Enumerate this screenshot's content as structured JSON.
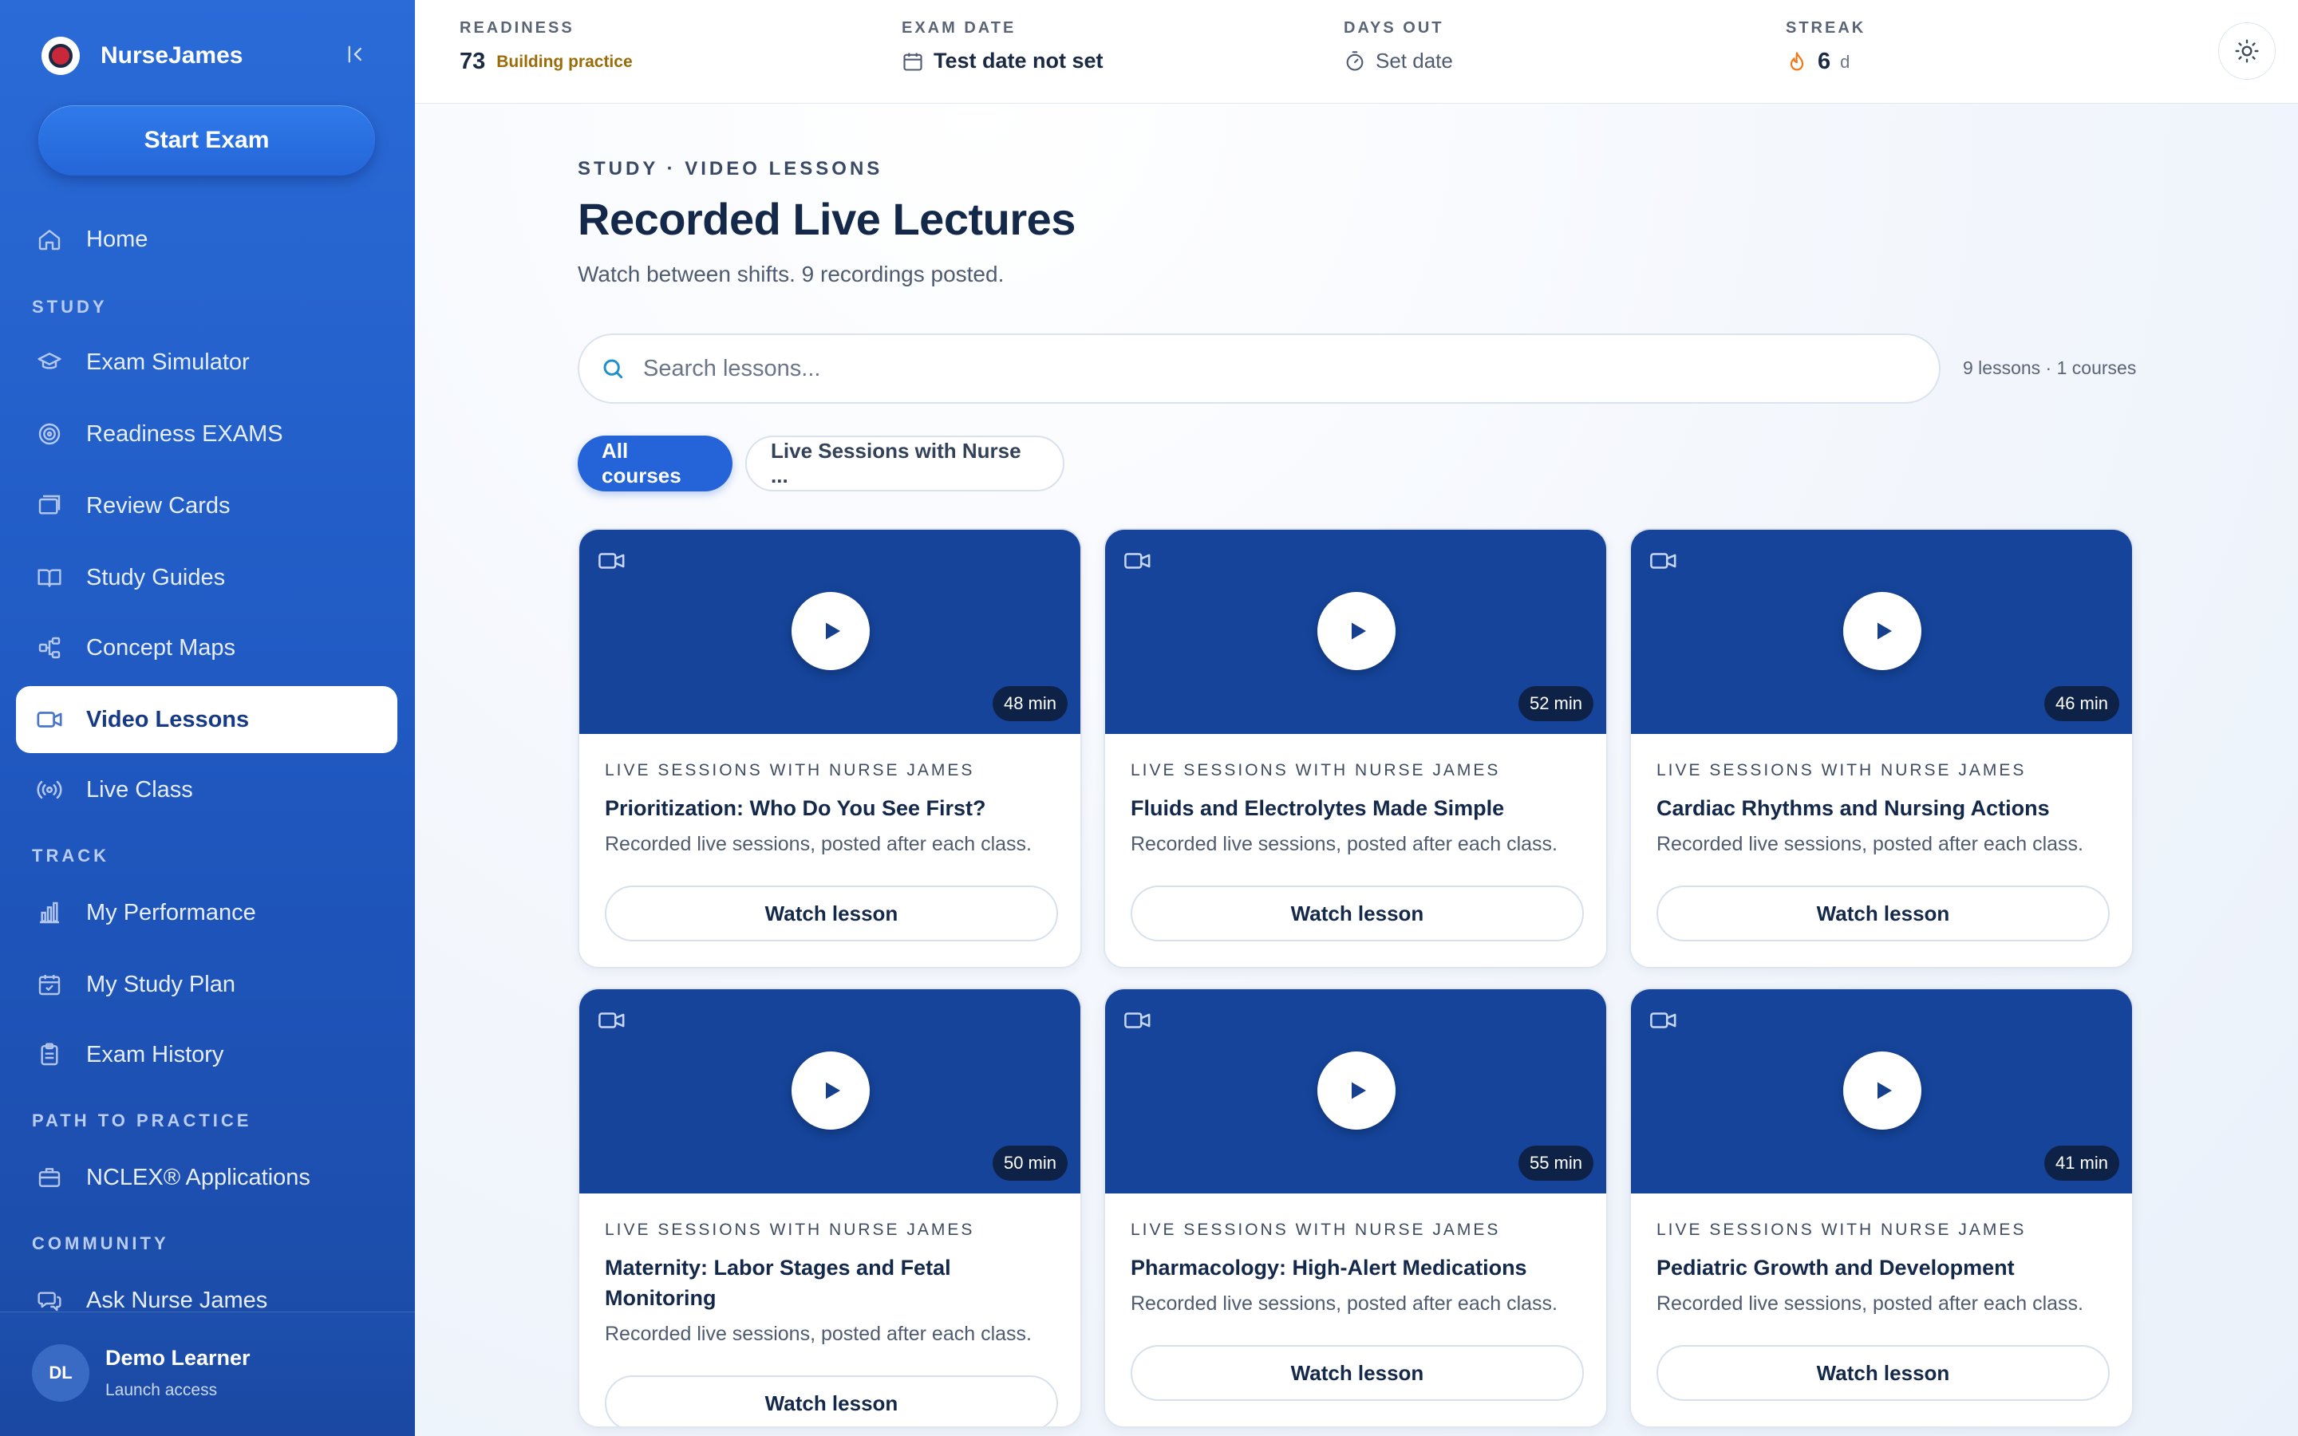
{
  "brand": {
    "name": "NurseJames"
  },
  "sidebar": {
    "start_button": "Start Exam",
    "home": "Home",
    "sections": {
      "study": "STUDY",
      "track": "TRACK",
      "path": "PATH TO PRACTICE",
      "community": "COMMUNITY"
    },
    "study_items": [
      {
        "label": "Exam Simulator",
        "icon": "graduation-cap-icon"
      },
      {
        "label": "Readiness EXAMS",
        "icon": "target-icon"
      },
      {
        "label": "Review Cards",
        "icon": "cards-icon"
      },
      {
        "label": "Study Guides",
        "icon": "book-icon"
      },
      {
        "label": "Concept Maps",
        "icon": "network-icon"
      },
      {
        "label": "Video Lessons",
        "icon": "video-icon",
        "active": true
      },
      {
        "label": "Live Class",
        "icon": "broadcast-icon"
      }
    ],
    "track_items": [
      {
        "label": "My Performance",
        "icon": "bar-chart-icon"
      },
      {
        "label": "My Study Plan",
        "icon": "calendar-check-icon"
      },
      {
        "label": "Exam History",
        "icon": "clipboard-icon"
      }
    ],
    "path_items": [
      {
        "label": "NCLEX® Applications",
        "icon": "briefcase-icon"
      }
    ],
    "community_items": [
      {
        "label": "Ask Nurse James",
        "icon": "chat-icon"
      }
    ],
    "user": {
      "initials": "DL",
      "name": "Demo Learner",
      "sub": "Launch access"
    }
  },
  "topbar": {
    "readiness": {
      "label": "READINESS",
      "value": "73",
      "note": "Building practice"
    },
    "exam_date": {
      "label": "EXAM DATE",
      "value": "Test date not set"
    },
    "days_out": {
      "label": "DAYS OUT",
      "value": "Set date"
    },
    "streak": {
      "label": "STREAK",
      "value": "6",
      "unit": "d"
    }
  },
  "main": {
    "eyebrow": "STUDY · VIDEO LESSONS",
    "title": "Recorded Live Lectures",
    "subtitle": "Watch between shifts. 9 recordings posted.",
    "search_placeholder": "Search lessons...",
    "count_meta": "9 lessons · 1 courses",
    "filters": [
      "All courses",
      "Live Sessions with Nurse ..."
    ],
    "cards": [
      {
        "eyebrow": "LIVE SESSIONS WITH NURSE JAMES",
        "title": "Prioritization: Who Do You See First?",
        "desc": "Recorded live sessions, posted after each class.",
        "duration": "48 min",
        "button": "Watch lesson"
      },
      {
        "eyebrow": "LIVE SESSIONS WITH NURSE JAMES",
        "title": "Fluids and Electrolytes Made Simple",
        "desc": "Recorded live sessions, posted after each class.",
        "duration": "52 min",
        "button": "Watch lesson"
      },
      {
        "eyebrow": "LIVE SESSIONS WITH NURSE JAMES",
        "title": "Cardiac Rhythms and Nursing Actions",
        "desc": "Recorded live sessions, posted after each class.",
        "duration": "46 min",
        "button": "Watch lesson"
      },
      {
        "eyebrow": "LIVE SESSIONS WITH NURSE JAMES",
        "title": "Maternity: Labor Stages and Fetal Monitoring",
        "desc": "Recorded live sessions, posted after each class.",
        "duration": "50 min",
        "button": "Watch lesson"
      },
      {
        "eyebrow": "LIVE SESSIONS WITH NURSE JAMES",
        "title": "Pharmacology: High-Alert Medications",
        "desc": "Recorded live sessions, posted after each class.",
        "duration": "55 min",
        "button": "Watch lesson"
      },
      {
        "eyebrow": "LIVE SESSIONS WITH NURSE JAMES",
        "title": "Pediatric Growth and Development",
        "desc": "Recorded live sessions, posted after each class.",
        "duration": "41 min",
        "button": "Watch lesson"
      }
    ]
  },
  "colors": {
    "sidebar": "#2a6bd8",
    "accent": "#2563d8",
    "thumb": "#15449a",
    "readiness_note": "#9a6b06",
    "streak_flame": "#f07a1a"
  }
}
